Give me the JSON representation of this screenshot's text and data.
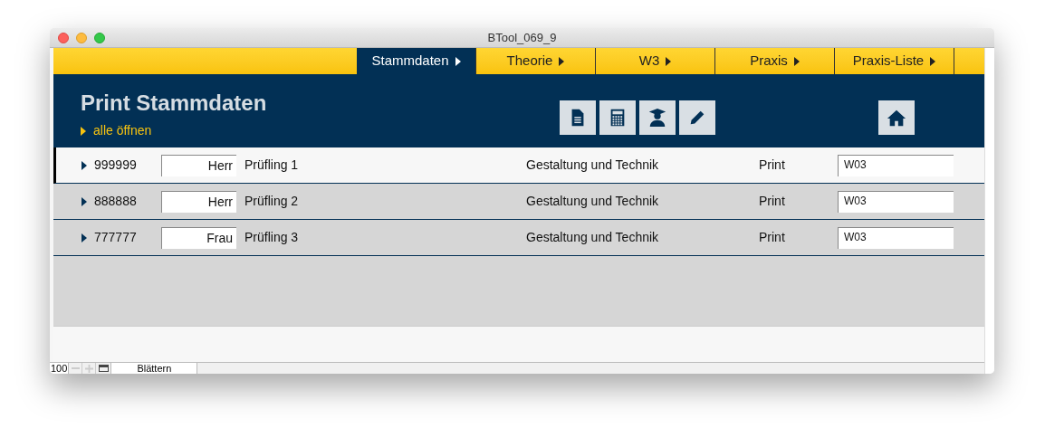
{
  "window": {
    "title": "BTool_069_9"
  },
  "tabs": [
    {
      "label": "Stammdaten",
      "selected": true
    },
    {
      "label": "Theorie",
      "selected": false
    },
    {
      "label": "W3",
      "selected": false
    },
    {
      "label": "Praxis",
      "selected": false
    },
    {
      "label": "Praxis-Liste",
      "selected": false
    }
  ],
  "header": {
    "title": "Print Stammdaten",
    "expand_all": "alle öffnen"
  },
  "rows": [
    {
      "id": "999999",
      "salutation": "Herr",
      "name": "Prüfling 1",
      "subject": "Gestaltung und Technik",
      "type": "Print",
      "code": "W03",
      "selected": true
    },
    {
      "id": "888888",
      "salutation": "Herr",
      "name": "Prüfling 2",
      "subject": "Gestaltung und Technik",
      "type": "Print",
      "code": "W03",
      "selected": false
    },
    {
      "id": "777777",
      "salutation": "Frau",
      "name": "Prüfling 3",
      "subject": "Gestaltung und Technik",
      "type": "Print",
      "code": "W03",
      "selected": false
    }
  ],
  "status_bar": {
    "zoom": "100",
    "mode": "Blättern"
  }
}
